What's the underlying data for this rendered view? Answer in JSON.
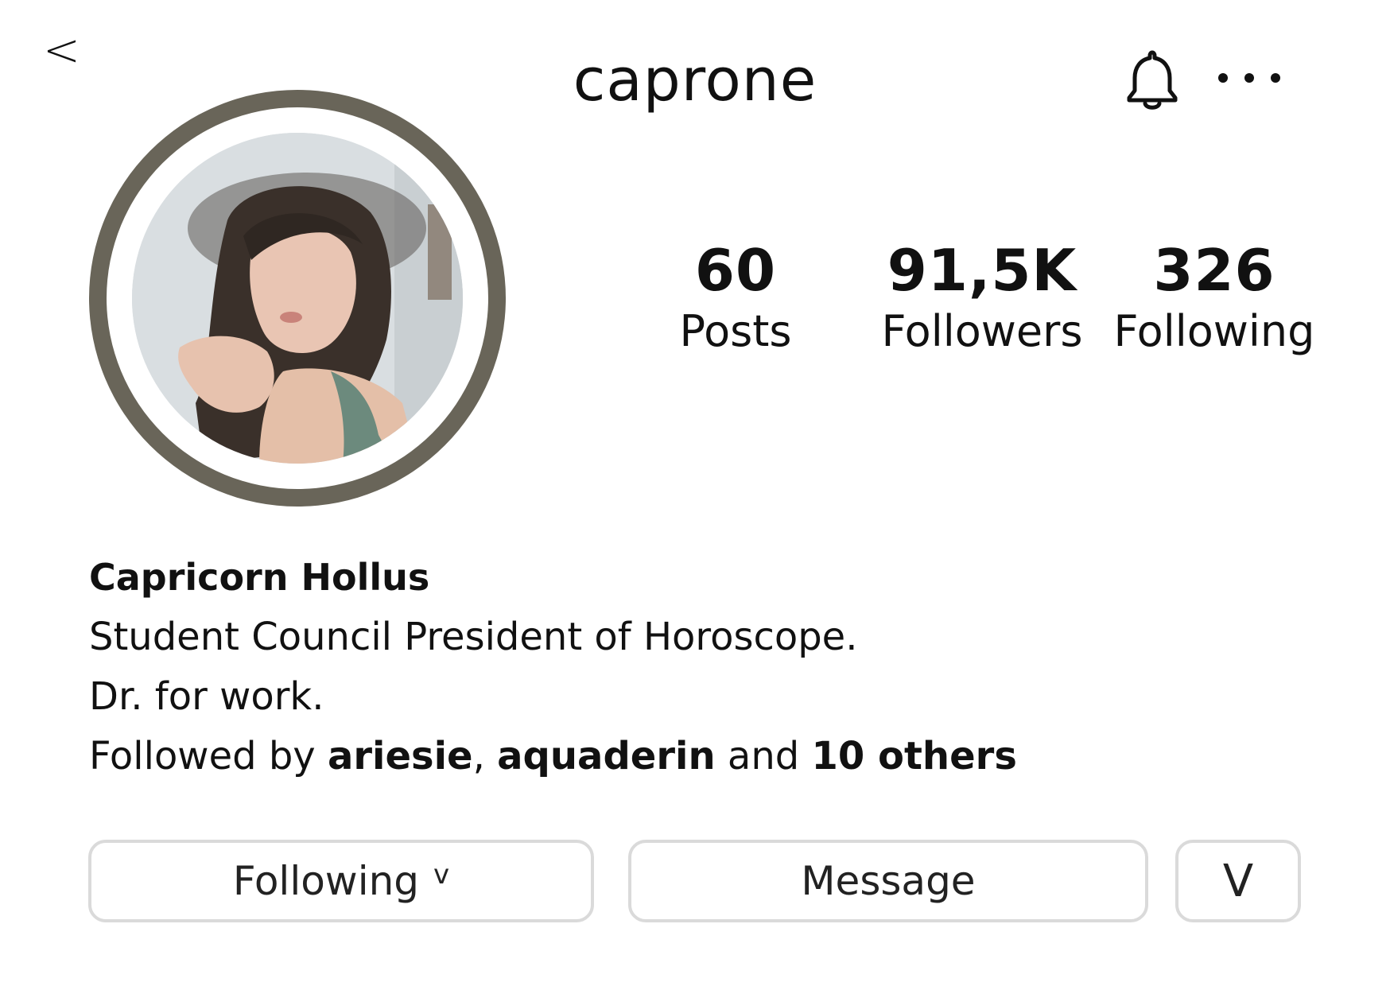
{
  "header": {
    "back_label": "<",
    "username": "caprone",
    "bell_icon": "bell-icon",
    "more_icon": "more-horizontal-icon"
  },
  "profile": {
    "avatar_ring_color": "#696559"
  },
  "stats": [
    {
      "value": "60",
      "label": "Posts"
    },
    {
      "value": "91,5K",
      "label": "Followers"
    },
    {
      "value": "326",
      "label": "Following"
    }
  ],
  "bio": {
    "name": "Capricorn Hollus",
    "line1": "Student Council President of Horoscope.",
    "line2": "Dr. for work.",
    "followed_by_prefix": "Followed by ",
    "follower1": "ariesie",
    "separator": ", ",
    "follower2": "aquaderin",
    "and_text": " and ",
    "others": "10 others"
  },
  "buttons": {
    "following_label": "Following",
    "following_chevron": "v",
    "message_label": "Message",
    "more_label": "V"
  }
}
